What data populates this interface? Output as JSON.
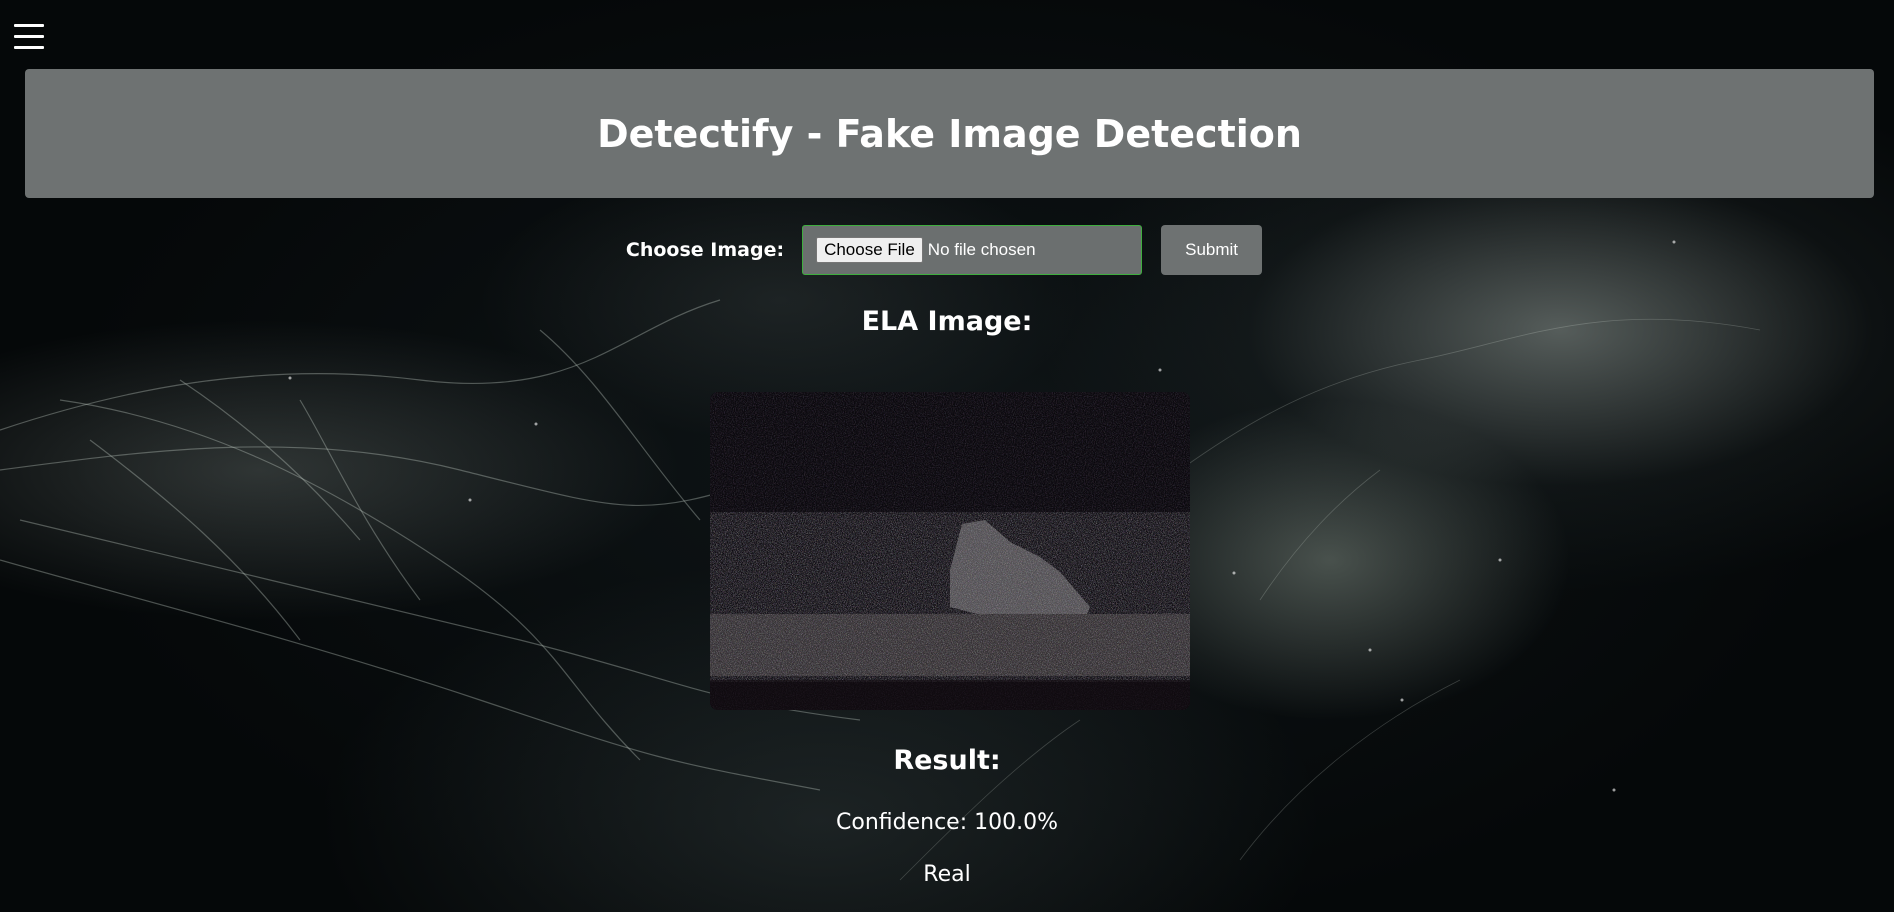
{
  "header": {
    "title": "Detectify - Fake Image Detection"
  },
  "upload_form": {
    "label": "Choose Image:",
    "file_button_label": "Choose File",
    "file_status": "No file chosen",
    "submit_label": "Submit"
  },
  "ela": {
    "title": "ELA Image:"
  },
  "result": {
    "title": "Result:",
    "confidence_text": "Confidence: 100.0%",
    "verdict": "Real"
  },
  "colors": {
    "header_bg": "#6e7272",
    "file_border": "#3fae3f",
    "page_bg": "#070b0c"
  },
  "icons": {
    "menu": "hamburger-menu-icon"
  }
}
